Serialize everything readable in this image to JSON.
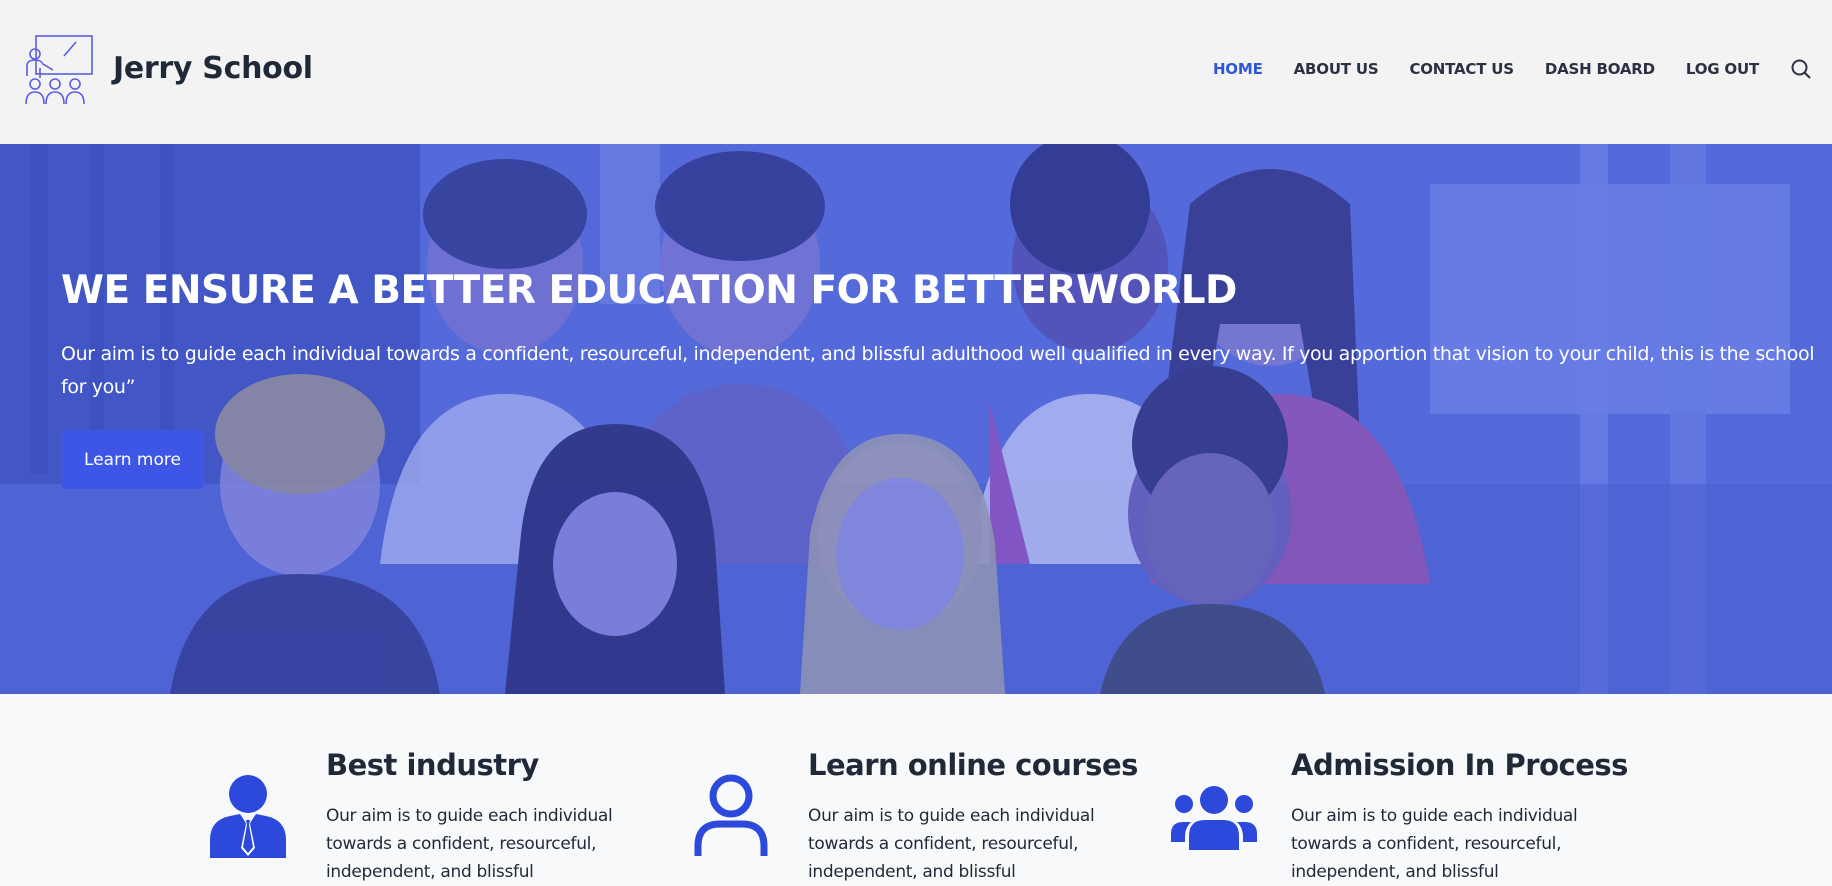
{
  "header": {
    "site_title": "Jerry School",
    "logo_icon": "classroom-teacher-icon",
    "nav": [
      {
        "label": "HOME",
        "active": true
      },
      {
        "label": "ABOUT US",
        "active": false
      },
      {
        "label": "CONTACT US",
        "active": false
      },
      {
        "label": "DASH BOARD",
        "active": false
      },
      {
        "label": "LOG OUT",
        "active": false
      }
    ],
    "search_icon": "search-icon"
  },
  "hero": {
    "title": "WE ENSURE A BETTER EDUCATION FOR BETTERWORLD",
    "text": " Our aim is to guide each individual towards a confident, resourceful, independent, and blissful adulthood well qualified in every way. If you apportion that vision to your child, this is the school for you”",
    "button_label": "Learn more",
    "background": "photo-of-smiling-children"
  },
  "features": [
    {
      "icon": "businessman-icon",
      "title": "Best industry",
      "text": "Our aim is to guide each individual towards a confident, resourceful, independent, and blissful"
    },
    {
      "icon": "user-outline-icon",
      "title": "Learn online courses",
      "text": "Our aim is to guide each individual towards a confident, resourceful, independent, and blissful"
    },
    {
      "icon": "group-icon",
      "title": "Admission In Process",
      "text": "Our aim is to guide each individual towards a confident, resourceful, independent, and blissful"
    }
  ],
  "colors": {
    "accent": "#2f56d8",
    "button": "#3d56e6",
    "header_bg": "#f3f3f3",
    "text_dark": "#1f2937",
    "icon_blue": "#2c49db"
  }
}
